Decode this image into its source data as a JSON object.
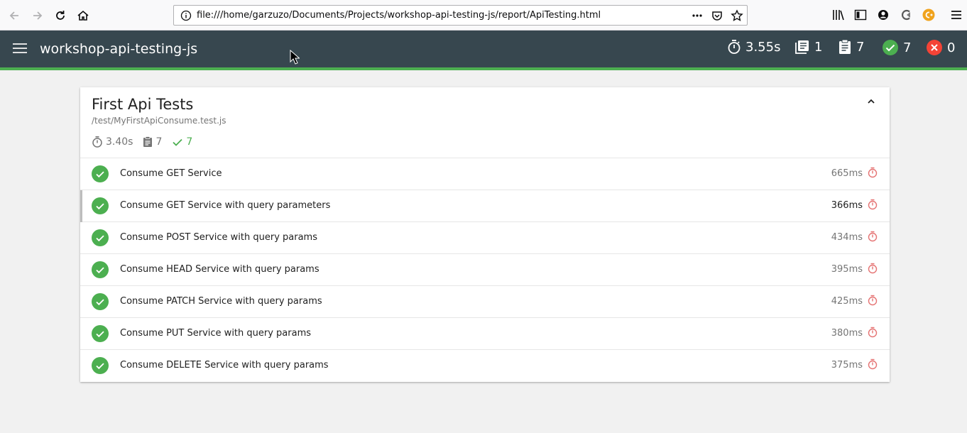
{
  "browser": {
    "url": "file:///home/garzuzo/Documents/Projects/workshop-api-testing-js/report/ApiTesting.html"
  },
  "header": {
    "title": "workshop-api-testing-js",
    "duration": "3.55s",
    "suites": "1",
    "tests": "7",
    "passed": "7",
    "failed": "0"
  },
  "suite": {
    "title": "First Api Tests",
    "file": "/test/MyFirstApiConsume.test.js",
    "duration": "3.40s",
    "tests": "7",
    "passed": "7"
  },
  "tests": [
    {
      "name": "Consume GET Service",
      "duration": "665ms"
    },
    {
      "name": "Consume GET Service with query parameters",
      "duration": "366ms"
    },
    {
      "name": "Consume POST Service with query params",
      "duration": "434ms"
    },
    {
      "name": "Consume HEAD Service with query params",
      "duration": "395ms"
    },
    {
      "name": "Consume PATCH Service with query params",
      "duration": "425ms"
    },
    {
      "name": "Consume PUT Service with query params",
      "duration": "380ms"
    },
    {
      "name": "Consume DELETE Service with query params",
      "duration": "375ms"
    }
  ],
  "colors": {
    "header_bg": "#37474f",
    "pass": "#4caf50",
    "fail": "#f44336",
    "timer": "#e57373"
  }
}
